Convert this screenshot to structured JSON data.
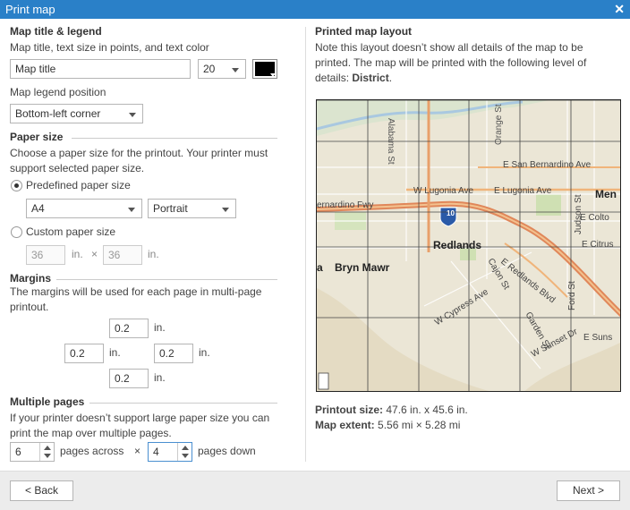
{
  "dialog": {
    "title": "Print map"
  },
  "map_title_section": {
    "heading": "Map title & legend",
    "subtitle": "Map title, text size in points, and text color",
    "title_value": "Map title",
    "text_size": "20",
    "text_color": "#000000",
    "legend_label": "Map legend position",
    "legend_position": "Bottom-left corner"
  },
  "paper": {
    "heading": "Paper size",
    "description": "Choose a paper size for the printout. Your printer must support selected paper size.",
    "predefined_label": "Predefined paper size",
    "paper_size": "A4",
    "orientation": "Portrait",
    "custom_label": "Custom paper size",
    "custom_width": "36",
    "custom_height": "36",
    "unit": "in.",
    "times": "×"
  },
  "margins": {
    "heading": "Margins",
    "description": "The margins will be used for each page in multi-page printout.",
    "top": "0.2",
    "left": "0.2",
    "right": "0.2",
    "bottom": "0.2",
    "unit": "in."
  },
  "pages": {
    "heading": "Multiple pages",
    "description": "If your printer doesn’t support large paper size you can print the map over multiple pages.",
    "across": "6",
    "across_label": "pages across",
    "times": "×",
    "down": "4",
    "down_label": "pages down"
  },
  "layout": {
    "heading": "Printed map layout",
    "note_prefix": "Note this layout doesn’t show all details of the map to be printed. The map will be printed with the following level of details: ",
    "note_level": "District",
    "note_suffix": ".",
    "printout_label": "Printout size:",
    "printout_value": "47.6 in. x 45.6 in.",
    "extent_label": "Map extent:",
    "extent_value": "5.56 mi × 5.28 mi"
  },
  "map_labels": {
    "alabama": "Alabama St",
    "orange": "Orange St",
    "sanbern": "E San Bernardino Ave",
    "lugonia_w": "W Lugonia Ave",
    "lugonia_e": "E Lugonia Ave",
    "tennessee": "Tennessee St",
    "judson": "Judson St",
    "ment": "Men",
    "bernfwy": "ernardino Fwy",
    "hwy": "10",
    "colton": "E Colto",
    "citrus": "E Citrus",
    "redlands": "Redlands",
    "brynmawr": "Bryn Mawr",
    "la": "a",
    "redlandsblvd": "E Redlands Blvd",
    "cajon": "Cajon St",
    "cypress": "W Cypress Ave",
    "garden": "Garden St",
    "sunset": "W Sunset Dr",
    "esuns": "E Suns",
    "ford": "Ford St"
  },
  "footer": {
    "back": "< Back",
    "next": "Next >"
  },
  "colors": {
    "titlebar": "#2a80c8",
    "map_bg": "#e9e4d4",
    "freeway": "#e0875a"
  }
}
